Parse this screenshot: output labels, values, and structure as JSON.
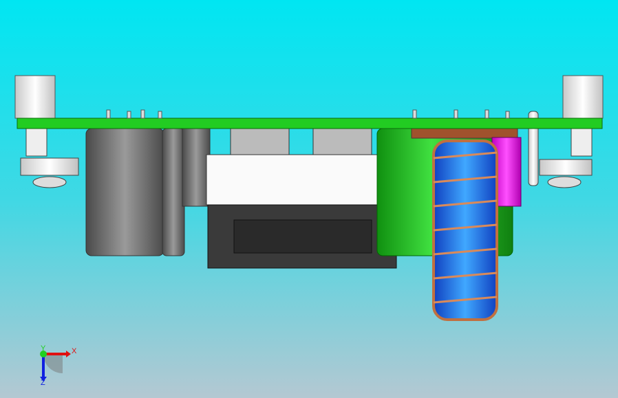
{
  "viewport": {
    "background_top": "#00e6f2",
    "background_bottom": "#b4c8d2"
  },
  "triad": {
    "x_label": "X",
    "y_label": "Y",
    "z_label": "Z",
    "x_color": "#e01010",
    "y_color": "#20d020",
    "z_color": "#1020e0"
  },
  "model": {
    "pcb_color": "#22cc22",
    "inductor_core_color": "#2a7fff",
    "coil_color": "#d98a5a",
    "highlight_color": "#ff00ff"
  }
}
